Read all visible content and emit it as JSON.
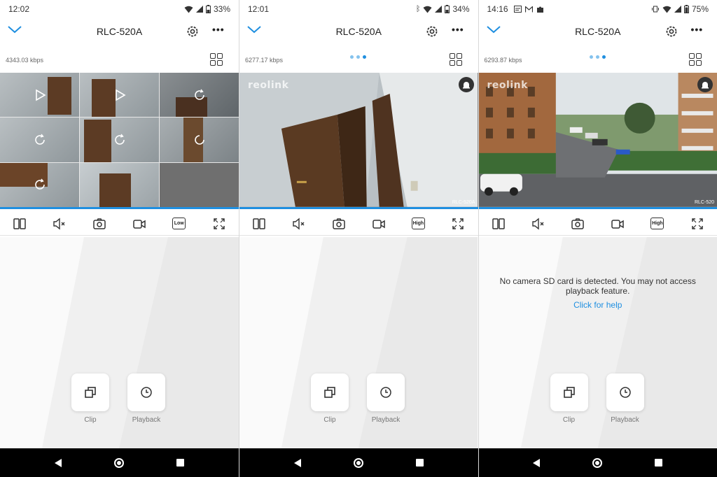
{
  "colors": {
    "accent": "#1f8fe0",
    "selection": "#58b4ff"
  },
  "panels": [
    {
      "status": {
        "time": "12:02",
        "battery": "33%",
        "left_icons": [],
        "right_icons": [
          "wifi-icon",
          "signal-icon",
          "battery-icon"
        ]
      },
      "header": {
        "title": "RLC-520A"
      },
      "bitrate": "4343.03 kbps",
      "show_pager": false,
      "quality": "Low",
      "notice": "",
      "help": "",
      "actions": {
        "clip": "Clip",
        "playback": "Playback"
      }
    },
    {
      "status": {
        "time": "12:01",
        "battery": "34%",
        "left_icons": [],
        "right_icons": [
          "bluetooth-icon",
          "wifi-icon",
          "signal-icon",
          "battery-icon"
        ]
      },
      "header": {
        "title": "RLC-520A"
      },
      "bitrate": "6277.17 kbps",
      "show_pager": true,
      "watermark": "reolink",
      "cam_label": "RLC-520A",
      "quality": "High",
      "notice": "",
      "help": "",
      "actions": {
        "clip": "Clip",
        "playback": "Playback"
      }
    },
    {
      "status": {
        "time": "14:16",
        "battery": "75%",
        "left_icons": [
          "notification-icon",
          "gmail-icon",
          "puzzle-icon"
        ],
        "right_icons": [
          "vibrate-icon",
          "wifi-icon",
          "signal-icon",
          "battery-icon"
        ]
      },
      "header": {
        "title": "RLC-520A"
      },
      "bitrate": "6293.87 kbps",
      "show_pager": true,
      "watermark": "reolink",
      "cam_label": "RLC-520",
      "quality": "High",
      "notice": "No camera SD card is detected. You may not access playback feature.",
      "help": "Click for help",
      "actions": {
        "clip": "Clip",
        "playback": "Playback"
      }
    }
  ]
}
